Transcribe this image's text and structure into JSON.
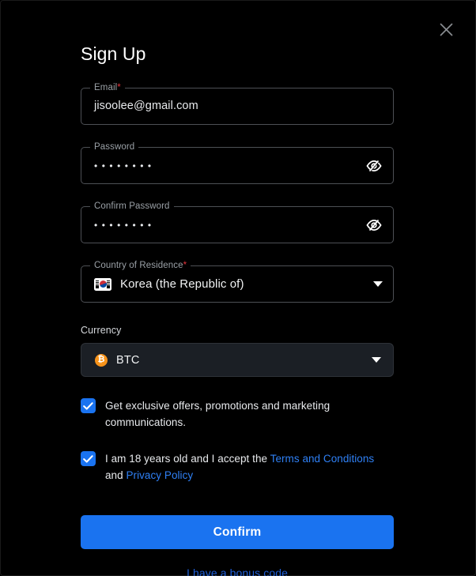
{
  "modal": {
    "title": "Sign Up",
    "close_icon": "close-icon"
  },
  "fields": {
    "email": {
      "label": "Email",
      "required_mark": "*",
      "value": "jisoolee@gmail.com"
    },
    "password": {
      "label": "Password",
      "value": "••••••••",
      "toggle_icon": "eye-off-icon"
    },
    "confirm_password": {
      "label": "Confirm Password",
      "value": "••••••••",
      "toggle_icon": "eye-off-icon"
    },
    "country": {
      "label": "Country of Residence",
      "required_mark": "*",
      "value": "Korea (the Republic of)",
      "flag": "south-korea-flag-icon",
      "caret_icon": "chevron-down-icon"
    },
    "currency": {
      "label": "Currency",
      "value": "BTC",
      "coin_symbol": "₿",
      "coin_icon": "bitcoin-icon",
      "caret_icon": "chevron-down-icon"
    }
  },
  "checkboxes": {
    "marketing": {
      "checked": true,
      "text": "Get exclusive offers, promotions and marketing communications."
    },
    "terms": {
      "checked": true,
      "text_before": "I am 18 years old and I accept the ",
      "link_terms": "Terms and Conditions",
      "text_middle": " and ",
      "link_privacy": "Privacy Policy"
    }
  },
  "actions": {
    "confirm_label": "Confirm",
    "bonus_label": "I have a bonus code"
  },
  "colors": {
    "background": "#000000",
    "accent_blue": "#1a73f0",
    "link_blue": "#2f80f5",
    "bonus_blue": "#1f5fd8",
    "bitcoin_orange": "#f7931a",
    "required_red": "#e5333b",
    "border_grey": "#4d5055"
  }
}
